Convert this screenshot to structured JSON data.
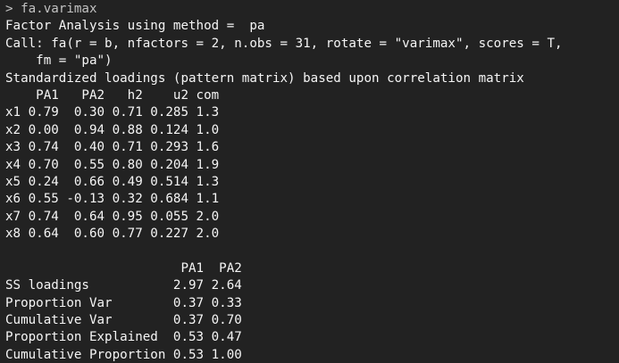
{
  "console": {
    "prompt_symbol": ">",
    "command": "fa.varimax",
    "output_header": [
      "Factor Analysis using method =  pa",
      "Call: fa(r = b, nfactors = 2, n.obs = 31, rotate = \"varimax\", scores = T, ",
      "    fm = \"pa\")",
      "Standardized loadings (pattern matrix) based upon correlation matrix"
    ],
    "loadings_table": {
      "header": "    PA1   PA2   h2    u2 com",
      "rows": [
        "x1 0.79  0.30 0.71 0.285 1.3",
        "x2 0.00  0.94 0.88 0.124 1.0",
        "x3 0.74  0.40 0.71 0.293 1.6",
        "x4 0.70  0.55 0.80 0.204 1.9",
        "x5 0.24  0.66 0.49 0.514 1.3",
        "x6 0.55 -0.13 0.32 0.684 1.1",
        "x7 0.74  0.64 0.95 0.055 2.0",
        "x8 0.64  0.60 0.77 0.227 2.0"
      ]
    },
    "variance_table": {
      "header": "                       PA1  PA2",
      "rows": [
        "SS loadings           2.97 2.64",
        "Proportion Var        0.37 0.33",
        "Cumulative Var        0.37 0.70",
        "Proportion Explained  0.53 0.47",
        "Cumulative Proportion 0.53 1.00"
      ]
    }
  },
  "colors": {
    "background": "#222222",
    "text": "#f5f5f5",
    "command": "#c2c2c2"
  }
}
